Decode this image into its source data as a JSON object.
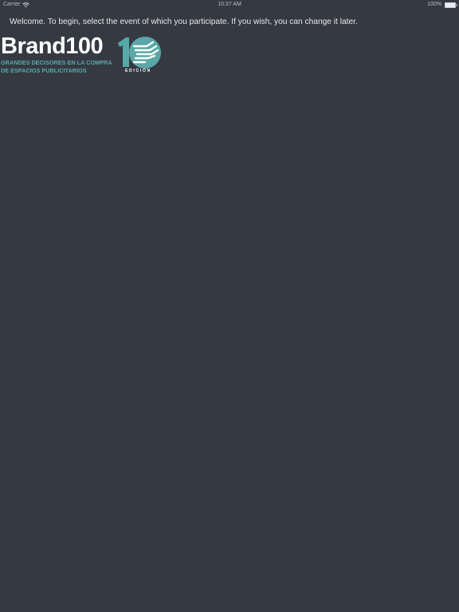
{
  "status_bar": {
    "carrier": "Carrier",
    "time": "10:37 AM",
    "battery": "100%"
  },
  "welcome_text": "Welcome. To begin, select the event of which you participate. If you wish, you can change it later.",
  "logo": {
    "wordmark": "Brand100",
    "tagline_line1": "GRANDES DECISORES EN LA COMPRA",
    "tagline_line2": "DE ESPACIOS PUBLICITARIOS",
    "edition_label": "EDICIÓN",
    "accent_color": "#58a8a8"
  },
  "colors": {
    "background": "#353a42",
    "text": "#e6e8eb"
  }
}
